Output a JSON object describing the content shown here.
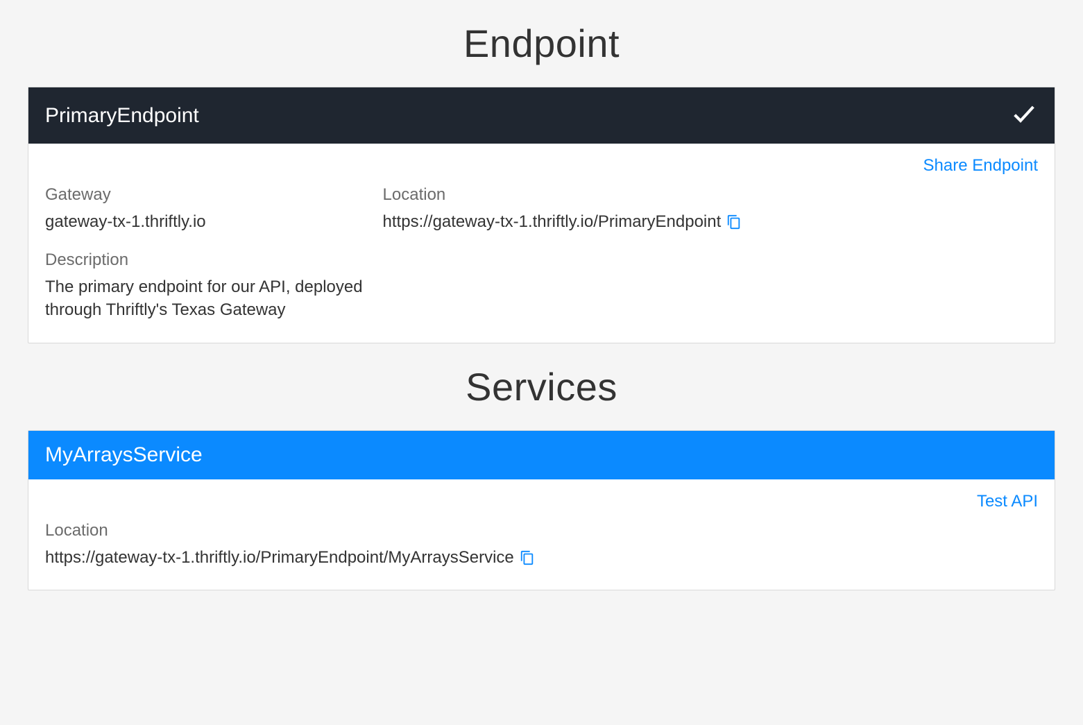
{
  "sections": {
    "endpoint_title": "Endpoint",
    "services_title": "Services"
  },
  "endpoint": {
    "name": "PrimaryEndpoint",
    "share_link_label": "Share Endpoint",
    "fields": {
      "gateway_label": "Gateway",
      "gateway_value": "gateway-tx-1.thriftly.io",
      "location_label": "Location",
      "location_value": "https://gateway-tx-1.thriftly.io/PrimaryEndpoint",
      "description_label": "Description",
      "description_value": "The primary endpoint for our API, deployed through Thriftly's Texas Gateway"
    },
    "icons": {
      "status": "check-icon",
      "copy": "copy-icon"
    }
  },
  "services": [
    {
      "name": "MyArraysService",
      "test_link_label": "Test API",
      "location_label": "Location",
      "location_value": "https://gateway-tx-1.thriftly.io/PrimaryEndpoint/MyArraysService"
    }
  ],
  "colors": {
    "header_dark": "#1f2630",
    "header_blue": "#0b8aff",
    "link_blue": "#0b8aff"
  }
}
